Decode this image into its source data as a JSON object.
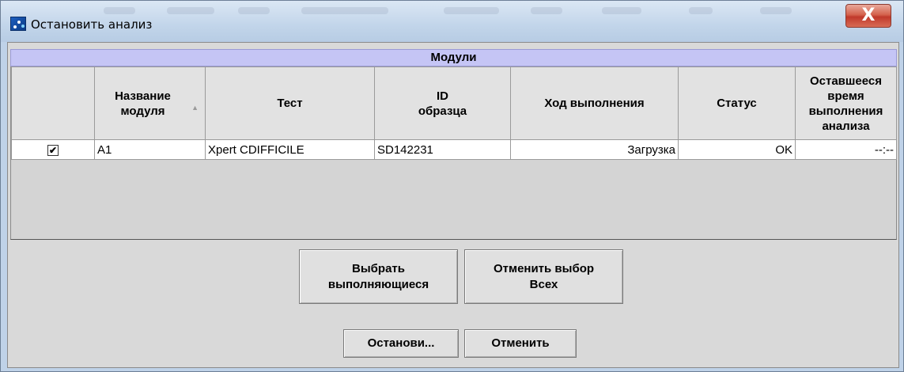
{
  "window": {
    "title": "Остановить анализ",
    "close_label": "X"
  },
  "modules": {
    "header": "Модули",
    "columns": [
      "",
      "Название модуля",
      "Тест",
      "ID образца",
      "Ход выполнения",
      "Статус",
      "Оставшееся время выполнения анализа"
    ],
    "rows": [
      {
        "checked": true,
        "check_glyph": "✔",
        "module": "A1",
        "test": "Xpert CDIFFICILE",
        "sample_id": "SD142231",
        "progress": "Загрузка",
        "status": "OK",
        "remaining": "--:--"
      }
    ]
  },
  "buttons": {
    "select_running": "Выбрать выполняющиеся",
    "deselect_all": "Отменить выбор Всех",
    "stop": "Останови...",
    "cancel": "Отменить"
  },
  "colors": {
    "section_header_bg": "#c5c5f5",
    "close_button": "#c0392b"
  },
  "icons": {
    "app": "cepheid-app-icon",
    "sort": "sort-ascending-icon"
  }
}
